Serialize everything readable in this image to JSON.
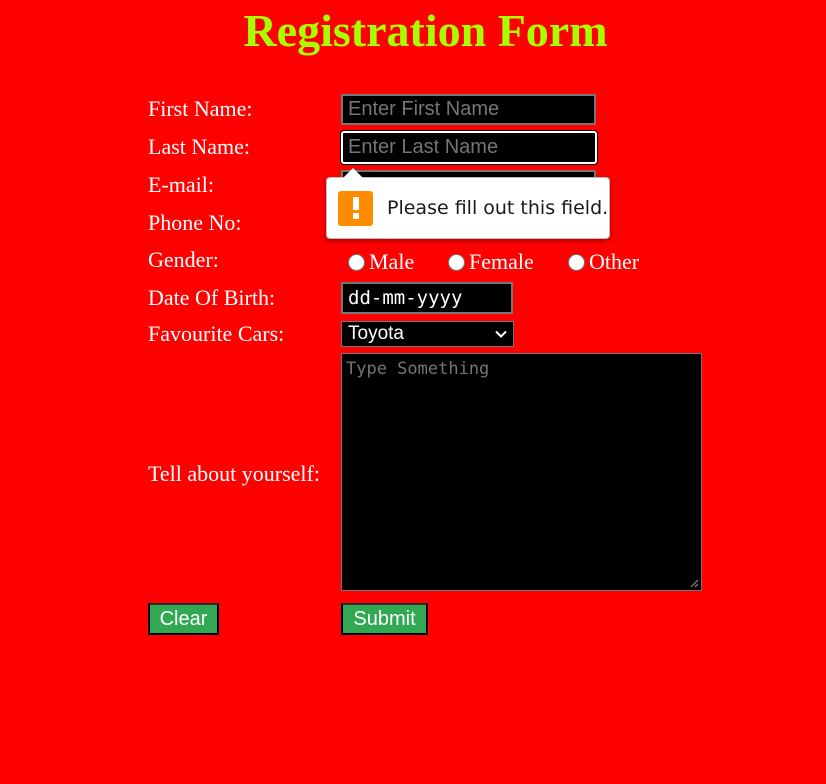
{
  "form": {
    "title": "Registration Form",
    "labels": {
      "first_name": "First Name:",
      "last_name": "Last Name:",
      "email": "E-mail:",
      "phone": "Phone No:",
      "gender": "Gender:",
      "dob": "Date Of Birth:",
      "cars": "Favourite Cars:",
      "about": "Tell about yourself:"
    },
    "placeholders": {
      "first_name": "Enter First Name",
      "last_name": "Enter Last Name",
      "about": "Type Something"
    },
    "gender_options": [
      "Male",
      "Female",
      "Other"
    ],
    "dob_value": "dd-mm-yyyy",
    "cars_selected": "Toyota",
    "buttons": {
      "clear": "Clear",
      "submit": "Submit"
    }
  },
  "validation_tooltip": {
    "message": "Please fill out this field.",
    "icon": "warning-icon"
  },
  "colors": {
    "background": "#ff0000",
    "title": "#a6ff00",
    "button": "#32a852",
    "field_background": "#000000",
    "warning": "#ff8c00"
  }
}
